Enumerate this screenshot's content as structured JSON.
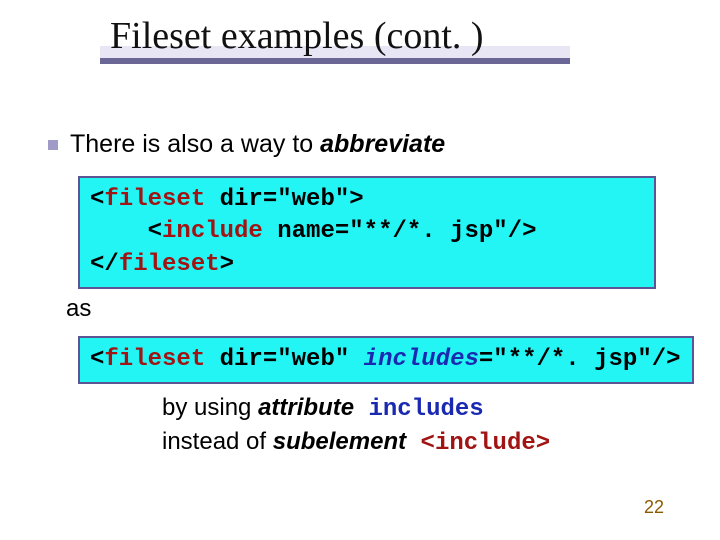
{
  "title": "Fileset examples (cont. )",
  "intro_prefix": "There is also a way to ",
  "intro_em": "abbreviate",
  "code1": {
    "l1_a": "<",
    "l1_tag": "fileset",
    "l1_b": " dir=\"web\">",
    "l2_a": "    <",
    "l2_tag": "include",
    "l2_b": " name=\"**/*. jsp\"/>",
    "l3_a": "</",
    "l3_tag": "fileset",
    "l3_b": ">"
  },
  "as_text": "as",
  "code2": {
    "a": "<",
    "tag": "fileset",
    "b": " dir=\"web\" ",
    "attr": "includes",
    "c": "=\"**/*. jsp\"/>"
  },
  "footer": {
    "line1_a": "by using ",
    "line1_em": "attribute",
    "line1_mono": " includes",
    "line2_a": "instead of ",
    "line2_em": "subelement",
    "line2_mono_a": " <",
    "line2_mono_tag": "include",
    "line2_mono_b": ">"
  },
  "pagenum": "22"
}
